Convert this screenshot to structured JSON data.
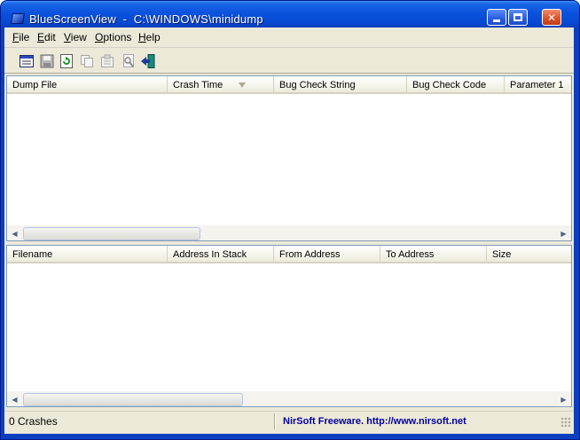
{
  "window": {
    "title": "BlueScreenView  -  C:\\WINDOWS\\minidump",
    "buttons": {
      "minimize": "minimize",
      "maximize": "maximize",
      "close": "✕"
    }
  },
  "menu": {
    "items": [
      {
        "ul": "F",
        "rest": "ile"
      },
      {
        "ul": "E",
        "rest": "dit"
      },
      {
        "ul": "V",
        "rest": "iew"
      },
      {
        "ul": "O",
        "rest": "ptions"
      },
      {
        "ul": "H",
        "rest": "elp"
      }
    ]
  },
  "toolbar": {
    "icons": [
      "html-report-icon",
      "save-icon",
      "refresh-icon",
      "copy-icon",
      "properties-icon",
      "find-icon",
      "exit-icon"
    ]
  },
  "upper_table": {
    "columns": [
      "Dump File",
      "Crash Time",
      "Bug Check String",
      "Bug Check Code",
      "Parameter 1"
    ]
  },
  "lower_table": {
    "columns": [
      "Filename",
      "Address In Stack",
      "From Address",
      "To Address",
      "Size"
    ]
  },
  "status": {
    "count": "0 Crashes",
    "credit": "NirSoft Freeware.  http://www.nirsoft.net"
  },
  "colors": {
    "titlebar": "#0a52dc",
    "credit_text": "#0000a0",
    "face": "#ece9d8"
  }
}
